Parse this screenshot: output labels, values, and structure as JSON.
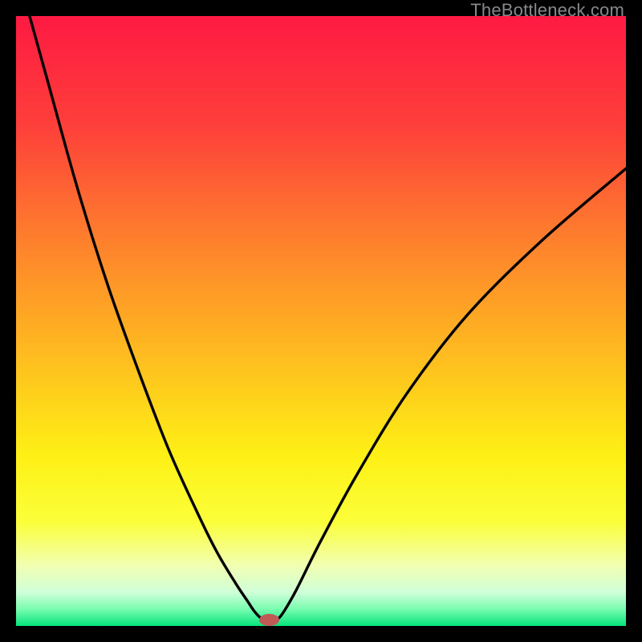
{
  "watermark": "TheBottleneck.com",
  "colors": {
    "frame": "#000000",
    "watermark": "#86898c",
    "curve": "#000000",
    "marker": "#c05a55",
    "gradient_stops": [
      {
        "pos": 0.0,
        "color": "#fe1a43"
      },
      {
        "pos": 0.18,
        "color": "#fe3f3a"
      },
      {
        "pos": 0.35,
        "color": "#fe7a2e"
      },
      {
        "pos": 0.55,
        "color": "#feba20"
      },
      {
        "pos": 0.72,
        "color": "#fef015"
      },
      {
        "pos": 0.83,
        "color": "#fbff3a"
      },
      {
        "pos": 0.9,
        "color": "#f2ffb0"
      },
      {
        "pos": 0.945,
        "color": "#cfffd8"
      },
      {
        "pos": 0.972,
        "color": "#7afcb0"
      },
      {
        "pos": 1.0,
        "color": "#05e47d"
      }
    ]
  },
  "chart_data": {
    "type": "line",
    "title": "",
    "xlabel": "",
    "ylabel": "",
    "xlim": [
      0,
      100
    ],
    "ylim": [
      0,
      100
    ],
    "notes": "V-shaped bottleneck curve. Values are read off the rendered image in percent of plot area; y is distance from top (0) to bottom (100). Minimum near x≈41.",
    "series": [
      {
        "name": "bottleneck-curve",
        "x": [
          0,
          5,
          10,
          15,
          20,
          25,
          30,
          33,
          36,
          38,
          39,
          40,
          41,
          42,
          43,
          44,
          46,
          50,
          56,
          64,
          74,
          86,
          100
        ],
        "y": [
          -8,
          10,
          28,
          44,
          58,
          71,
          82,
          88,
          93,
          96,
          97.5,
          98.6,
          99.2,
          99.2,
          98.8,
          97.5,
          94,
          86,
          75,
          62,
          49,
          37,
          25
        ]
      }
    ],
    "marker": {
      "x": 41.5,
      "y": 99.0,
      "rx": 1.6,
      "ry": 1.0
    }
  }
}
